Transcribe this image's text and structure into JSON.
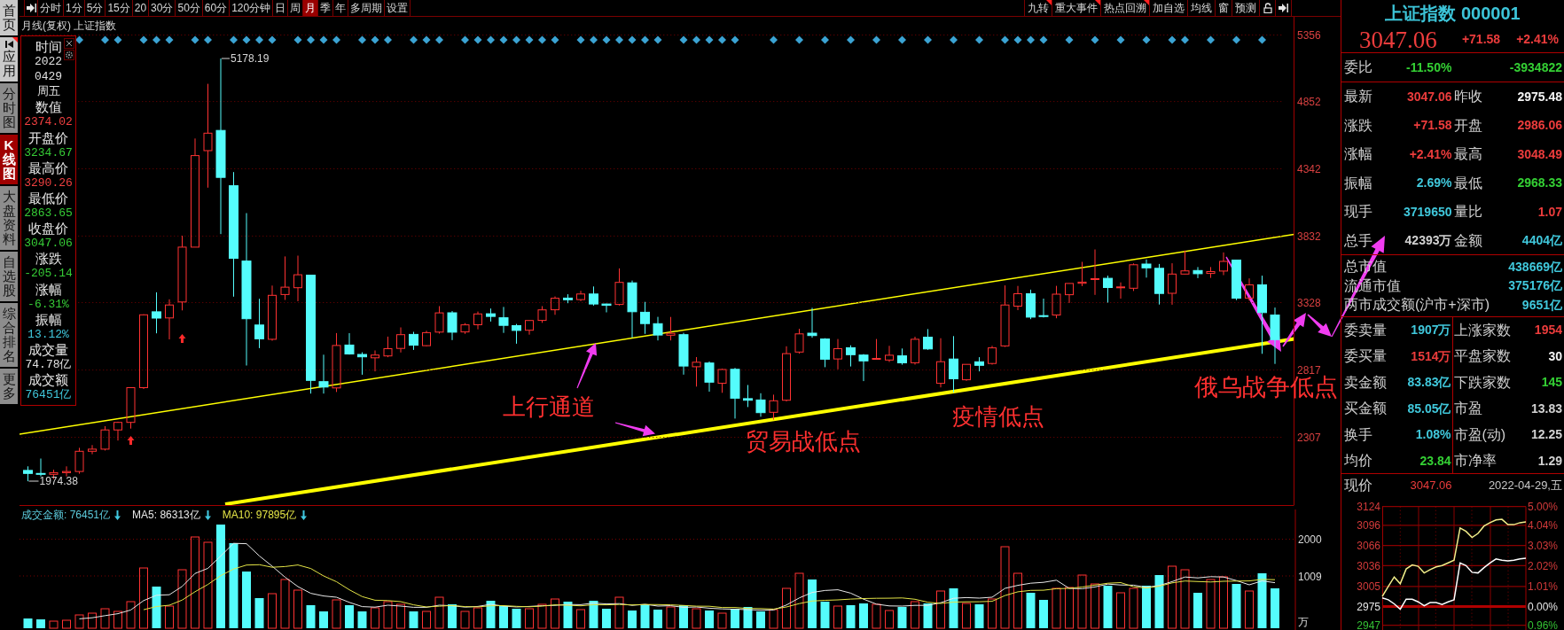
{
  "side_tabs": [
    {
      "label": "首页",
      "kind": "home",
      "selected": false
    },
    {
      "label": "应用",
      "kind": "app",
      "selected": false
    },
    {
      "label": "分时图",
      "kind": "view",
      "selected": false
    },
    {
      "label": "K线图",
      "kind": "view",
      "selected": true
    },
    {
      "label": "大盘资料",
      "kind": "view",
      "selected": false
    },
    {
      "label": "自选股",
      "kind": "view",
      "selected": false
    },
    {
      "label": "综合排名",
      "kind": "view",
      "selected": false
    },
    {
      "label": "更多",
      "kind": "view",
      "selected": false
    }
  ],
  "period_tabs": [
    {
      "label": "分时",
      "selected": false
    },
    {
      "label": "1分",
      "selected": false
    },
    {
      "label": "5分",
      "selected": false
    },
    {
      "label": "15分",
      "selected": false
    },
    {
      "label": "20",
      "selected": false
    },
    {
      "label": "30分",
      "selected": false
    },
    {
      "label": "50分",
      "selected": false
    },
    {
      "label": "60分",
      "selected": false
    },
    {
      "label": "120分钟",
      "selected": false
    },
    {
      "label": "日",
      "selected": false
    },
    {
      "label": "周",
      "selected": false
    },
    {
      "label": "月",
      "selected": true
    },
    {
      "label": "季",
      "selected": false
    },
    {
      "label": "年",
      "selected": false
    },
    {
      "label": "多周期",
      "selected": false
    },
    {
      "label": "设置",
      "selected": false
    }
  ],
  "tool_buttons": [
    {
      "label": "九转",
      "flagged": true
    },
    {
      "label": "重大事件",
      "flagged": true
    },
    {
      "label": "热点回溯",
      "flagged": true
    },
    {
      "label": "加自选",
      "flagged": false
    },
    {
      "label": "均线",
      "flagged": false
    },
    {
      "label": "窗",
      "flagged": false
    },
    {
      "label": "预测",
      "flagged": false
    }
  ],
  "chart": {
    "title": "月线(复权) 上证指数",
    "high_label": "5178.19",
    "low_label": "1974.38",
    "annotations": [
      "上行通道",
      "贸易战低点",
      "疫情低点",
      "俄乌战争低点"
    ],
    "chart_data": {
      "type": "candlestick",
      "grid": true,
      "ylim": [
        1793.3,
        5493.8
      ],
      "yticks": [
        {
          "value": 5356,
          "label": "5356"
        },
        {
          "value": 4852,
          "label": "4852"
        },
        {
          "value": 4342,
          "label": "4342"
        },
        {
          "value": 3832,
          "label": "3832"
        },
        {
          "value": 3328,
          "label": "3328"
        },
        {
          "value": 2817,
          "label": "2817"
        },
        {
          "value": 2307,
          "label": "2307"
        }
      ],
      "categories": [
        null,
        null,
        null,
        null,
        null,
        null,
        null,
        null,
        null,
        null,
        null,
        null,
        null,
        null,
        null,
        null,
        null,
        null,
        null,
        null,
        null,
        null,
        null,
        null,
        null,
        null,
        null,
        null,
        null,
        null,
        null,
        null,
        null,
        null,
        null,
        null,
        null,
        null,
        null,
        null,
        null,
        null,
        null,
        null,
        null,
        null,
        null,
        null,
        null,
        null,
        null,
        null,
        null,
        null,
        null,
        null,
        null,
        null,
        null,
        null,
        null,
        null,
        null,
        null,
        null,
        null,
        null,
        null,
        null,
        null,
        null,
        null,
        null,
        null,
        null,
        null,
        null,
        null,
        null,
        null,
        null,
        null,
        null,
        null,
        null,
        null,
        null,
        null,
        null,
        null,
        null,
        null,
        null,
        null,
        null,
        null,
        null,
        null
      ],
      "ohlc": [
        [
          2056,
          2087,
          1974,
          2033
        ],
        [
          2033,
          2146,
          2010,
          2026
        ],
        [
          2026,
          2061,
          1991,
          2039
        ],
        [
          2039,
          2087,
          2010,
          2048
        ],
        [
          2048,
          2227,
          2031,
          2201
        ],
        [
          2201,
          2248,
          2179,
          2217
        ],
        [
          2217,
          2391,
          2207,
          2363
        ],
        [
          2363,
          2425,
          2282,
          2420
        ],
        [
          2420,
          2683,
          2373,
          2683
        ],
        [
          2683,
          3239,
          2673,
          3235
        ],
        [
          3258,
          3406,
          3095,
          3210
        ],
        [
          3212,
          3353,
          3049,
          3310
        ],
        [
          3332,
          3835,
          3269,
          3748
        ],
        [
          3748,
          4572,
          3748,
          4442
        ],
        [
          4480,
          4986,
          4199,
          4612
        ],
        [
          4633,
          5178,
          3847,
          4277
        ],
        [
          4214,
          4317,
          3373,
          3664
        ],
        [
          3643,
          4006,
          2851,
          3206
        ],
        [
          3158,
          3357,
          2983,
          3053
        ],
        [
          3050,
          3457,
          3039,
          3383
        ],
        [
          3389,
          3678,
          3348,
          3445
        ],
        [
          3441,
          3684,
          3338,
          3539
        ],
        [
          3536,
          3538,
          2638,
          2738
        ],
        [
          2729,
          2933,
          2638,
          2688
        ],
        [
          2681,
          3097,
          2650,
          3003
        ],
        [
          3006,
          3096,
          2934,
          2938
        ],
        [
          2935,
          2951,
          2781,
          2917
        ],
        [
          2909,
          2965,
          2807,
          2930
        ],
        [
          2924,
          3070,
          2914,
          2979
        ],
        [
          2981,
          3140,
          2950,
          3085
        ],
        [
          3087,
          3106,
          2969,
          3005
        ],
        [
          3001,
          3114,
          2996,
          3100
        ],
        [
          3104,
          3301,
          3093,
          3250
        ],
        [
          3251,
          3264,
          3044,
          3104
        ],
        [
          3105,
          3172,
          3091,
          3159
        ],
        [
          3160,
          3260,
          3125,
          3242
        ],
        [
          3243,
          3283,
          3184,
          3223
        ],
        [
          3213,
          3295,
          3098,
          3155
        ],
        [
          3153,
          3166,
          3016,
          3117
        ],
        [
          3118,
          3194,
          3085,
          3192
        ],
        [
          3193,
          3301,
          3175,
          3273
        ],
        [
          3274,
          3375,
          3235,
          3361
        ],
        [
          3362,
          3391,
          3323,
          3349
        ],
        [
          3351,
          3417,
          3339,
          3393
        ],
        [
          3393,
          3450,
          3305,
          3317
        ],
        [
          3317,
          3320,
          3254,
          3307
        ],
        [
          3314,
          3587,
          3306,
          3481
        ],
        [
          3478,
          3495,
          3062,
          3259
        ],
        [
          3255,
          3333,
          3091,
          3169
        ],
        [
          3168,
          3220,
          3041,
          3082
        ],
        [
          3081,
          3219,
          3041,
          3095
        ],
        [
          3085,
          3099,
          2782,
          2847
        ],
        [
          2842,
          2915,
          2691,
          2876
        ],
        [
          2870,
          2882,
          2653,
          2725
        ],
        [
          2717,
          2827,
          2644,
          2821
        ],
        [
          2822,
          2833,
          2449,
          2603
        ],
        [
          2600,
          2703,
          2536,
          2588
        ],
        [
          2590,
          2641,
          2463,
          2494
        ],
        [
          2497,
          2630,
          2440,
          2584
        ],
        [
          2588,
          2997,
          2579,
          2941
        ],
        [
          2953,
          3129,
          2941,
          3091
        ],
        [
          3096,
          3288,
          3061,
          3078
        ],
        [
          3052,
          3058,
          2838,
          2899
        ],
        [
          2901,
          3052,
          2822,
          2979
        ],
        [
          2986,
          3004,
          2844,
          2933
        ],
        [
          2930,
          2938,
          2733,
          2886
        ],
        [
          2902,
          3052,
          2896,
          2905
        ],
        [
          2893,
          3000,
          2878,
          2929
        ],
        [
          2924,
          2980,
          2857,
          2871
        ],
        [
          2872,
          3069,
          2858,
          3050
        ],
        [
          3066,
          3127,
          2970,
          2977
        ],
        [
          2716,
          3058,
          2685,
          2880
        ],
        [
          2900,
          3074,
          2647,
          2750
        ],
        [
          2743,
          2860,
          2735,
          2860
        ],
        [
          2879,
          2914,
          2807,
          2852
        ],
        [
          2867,
          3000,
          2858,
          2985
        ],
        [
          3000,
          3458,
          2992,
          3310
        ],
        [
          3301,
          3454,
          3271,
          3395
        ],
        [
          3395,
          3426,
          3202,
          3218
        ],
        [
          3229,
          3358,
          3215,
          3225
        ],
        [
          3234,
          3455,
          3209,
          3392
        ],
        [
          3388,
          3474,
          3325,
          3473
        ],
        [
          3474,
          3637,
          3453,
          3483
        ],
        [
          3505,
          3731,
          3386,
          3509
        ],
        [
          3512,
          3532,
          3328,
          3442
        ],
        [
          3446,
          3481,
          3358,
          3447
        ],
        [
          3437,
          3625,
          3416,
          3615
        ],
        [
          3620,
          3655,
          3517,
          3591
        ],
        [
          3588,
          3621,
          3313,
          3397
        ],
        [
          3398,
          3626,
          3312,
          3544
        ],
        [
          3544,
          3723,
          3542,
          3568
        ],
        [
          3571,
          3597,
          3513,
          3547
        ],
        [
          3549,
          3597,
          3515,
          3563
        ],
        [
          3567,
          3708,
          3536,
          3640
        ],
        [
          3650,
          3651,
          3347,
          3361
        ],
        [
          3362,
          3511,
          3343,
          3462
        ],
        [
          3463,
          3532,
          2940,
          3252
        ],
        [
          3234,
          3290,
          2863,
          3047
        ]
      ]
    }
  },
  "info_box": {
    "fields": [
      {
        "label": "时间",
        "values": [
          "2022",
          "0429",
          "周五"
        ],
        "color": "#e0e0e0"
      },
      {
        "label": "数值",
        "values": [
          "2374.02"
        ],
        "color": "#f04040"
      },
      {
        "label": "开盘价",
        "values": [
          "3234.67"
        ],
        "color": "#36cc36"
      },
      {
        "label": "最高价",
        "values": [
          "3290.26"
        ],
        "color": "#f04040"
      },
      {
        "label": "最低价",
        "values": [
          "2863.65"
        ],
        "color": "#36cc36"
      },
      {
        "label": "收盘价",
        "values": [
          "3047.06"
        ],
        "color": "#36cc36"
      },
      {
        "label": "涨跌",
        "values": [
          "-205.14"
        ],
        "color": "#36cc36"
      },
      {
        "label": "涨幅",
        "values": [
          "-6.31%"
        ],
        "color": "#36cc36"
      },
      {
        "label": "振幅",
        "values": [
          "13.12%"
        ],
        "color": "#40c8dc"
      },
      {
        "label": "成交量",
        "values": [
          "74.78亿"
        ],
        "color": "#e0e0e0"
      },
      {
        "label": "成交额",
        "values": [
          "76451亿"
        ],
        "color": "#40c8dc"
      }
    ]
  },
  "volume": {
    "legend": [
      {
        "text": "成交金额: 76451亿",
        "color": "#5ccadb"
      },
      {
        "text": "MA5: 86313亿",
        "color": "#e8e8e8"
      },
      {
        "text": "MA10: 97895亿",
        "color": "#e4e446"
      }
    ],
    "axis": [
      "2000",
      "1009",
      "万"
    ]
  },
  "quote": {
    "title": "上证指数 000001",
    "price": "3047.06",
    "change": "+71.58",
    "change_percent": "+2.41%",
    "rising": true
  },
  "order_ratio": {
    "label": "委比",
    "percent": "-11.50%",
    "difference": "-3934822",
    "rising": false
  },
  "stats": [
    {
      "label": "最新",
      "value": "3047.06",
      "color": "#ec3c3c"
    },
    {
      "label": "昨收",
      "value": "2975.48",
      "color": "#f4f4f4"
    },
    {
      "label": "涨跌",
      "value": "+71.58",
      "color": "#ec3c3c"
    },
    {
      "label": "开盘",
      "value": "2986.06",
      "color": "#ec3c3c"
    },
    {
      "label": "涨幅",
      "value": "+2.41%",
      "color": "#ec3c3c"
    },
    {
      "label": "最高",
      "value": "3048.49",
      "color": "#ec3c3c"
    },
    {
      "label": "振幅",
      "value": "2.69%",
      "color": "#40c8dc"
    },
    {
      "label": "最低",
      "value": "2968.33",
      "color": "#34d034"
    },
    {
      "label": "现手",
      "value": "3719650",
      "color": "#40c8dc"
    },
    {
      "label": "量比",
      "value": "1.07",
      "color": "#ec3c3c"
    },
    {
      "label": "总手",
      "value": "42393万",
      "color": "#d2d2d2"
    },
    {
      "label": "金额",
      "value": "4404亿",
      "color": "#40c8dc"
    }
  ],
  "market_totals": [
    {
      "label": "总市值",
      "value": "438669亿",
      "color": "#40c8dc"
    },
    {
      "label": "流通市值",
      "value": "375176亿",
      "color": "#40c8dc"
    },
    {
      "label": "两市成交额(沪市+深市)",
      "value": "9651亿",
      "color": "#40c8dc"
    }
  ],
  "breadth": [
    {
      "label": "委卖量",
      "value": "1907万",
      "color": "#40c8dc"
    },
    {
      "label": "上涨家数",
      "value": "1954",
      "color": "#ec3c3c"
    },
    {
      "label": "委买量",
      "value": "1514万",
      "color": "#ec3c3c"
    },
    {
      "label": "平盘家数",
      "value": "30",
      "color": "#f4f4f4"
    },
    {
      "label": "卖金额",
      "value": "83.83亿",
      "color": "#40c8dc"
    },
    {
      "label": "下跌家数",
      "value": "145",
      "color": "#34d034"
    },
    {
      "label": "买金额",
      "value": "85.05亿",
      "color": "#40c8dc"
    },
    {
      "label": "市盈",
      "value": "13.83",
      "color": "#d2d2d2"
    },
    {
      "label": "换手",
      "value": "1.08%",
      "color": "#40c8dc"
    },
    {
      "label": "市盈(动)",
      "value": "12.25",
      "color": "#d2d2d2"
    },
    {
      "label": "均价",
      "value": "23.84",
      "color": "#34d034"
    },
    {
      "label": "市净率",
      "value": "1.29",
      "color": "#d2d2d2"
    }
  ],
  "intraday": {
    "label": "现价",
    "price": "3047.06",
    "rising": true,
    "date": "2022-04-29,五",
    "price_ticks": [
      {
        "color": "#d23a3a"
      },
      {
        "color": "#d23a3a"
      },
      {
        "color": "#d23a3a"
      },
      {
        "color": "#d23a3a"
      },
      {
        "color": "#d23a3a"
      },
      {
        "color": "#e6e6e6"
      },
      {
        "color": "#34c034"
      }
    ],
    "percent_ticks": [
      {
        "text": "5.00%",
        "color": "#d23a3a"
      },
      {
        "text": "4.04%",
        "color": "#d23a3a"
      },
      {
        "text": "3.03%",
        "color": "#d23a3a"
      },
      {
        "text": "2.02%",
        "color": "#d23a3a"
      },
      {
        "text": "1.01%",
        "color": "#d23a3a"
      },
      {
        "text": "0.00%",
        "color": "#e6e6e6"
      },
      {
        "text": "0.96%",
        "color": "#34c034"
      }
    ],
    "chart_data": {
      "type": "line",
      "grid": true,
      "ylim": [
        2940,
        3124
      ],
      "yticks": [
        {
          "value": 3124,
          "label": "3124"
        },
        {
          "value": 3096,
          "label": "3096"
        },
        {
          "value": 3066,
          "label": "3066"
        },
        {
          "value": 3036,
          "label": "3036"
        },
        {
          "value": 3005,
          "label": "3005"
        },
        {
          "value": 2975,
          "label": "2975"
        },
        {
          "value": 2947,
          "label": "2947"
        }
      ],
      "ref_lines": [
        {
          "axis": "y",
          "value": 2975
        }
      ],
      "series": [
        {
          "color": "#ffffff",
          "values": [
            2988,
            2985,
            2979,
            2971,
            2986,
            2986,
            2982,
            2976,
            2981,
            2981,
            2978,
            2982,
            2985,
            3040,
            3036,
            3026,
            3025,
            3033,
            3040,
            3046,
            3044,
            3043,
            3044,
            3046,
            3047
          ]
        },
        {
          "color": "#f2ee8a",
          "values": [
            2990,
            3005,
            3019,
            3009,
            3031,
            3037,
            3035,
            3025,
            3030,
            3034,
            3036,
            3040,
            3044,
            3092,
            3087,
            3078,
            3084,
            3095,
            3100,
            3104,
            3105,
            3097,
            3097,
            3100,
            3101
          ]
        }
      ]
    }
  }
}
